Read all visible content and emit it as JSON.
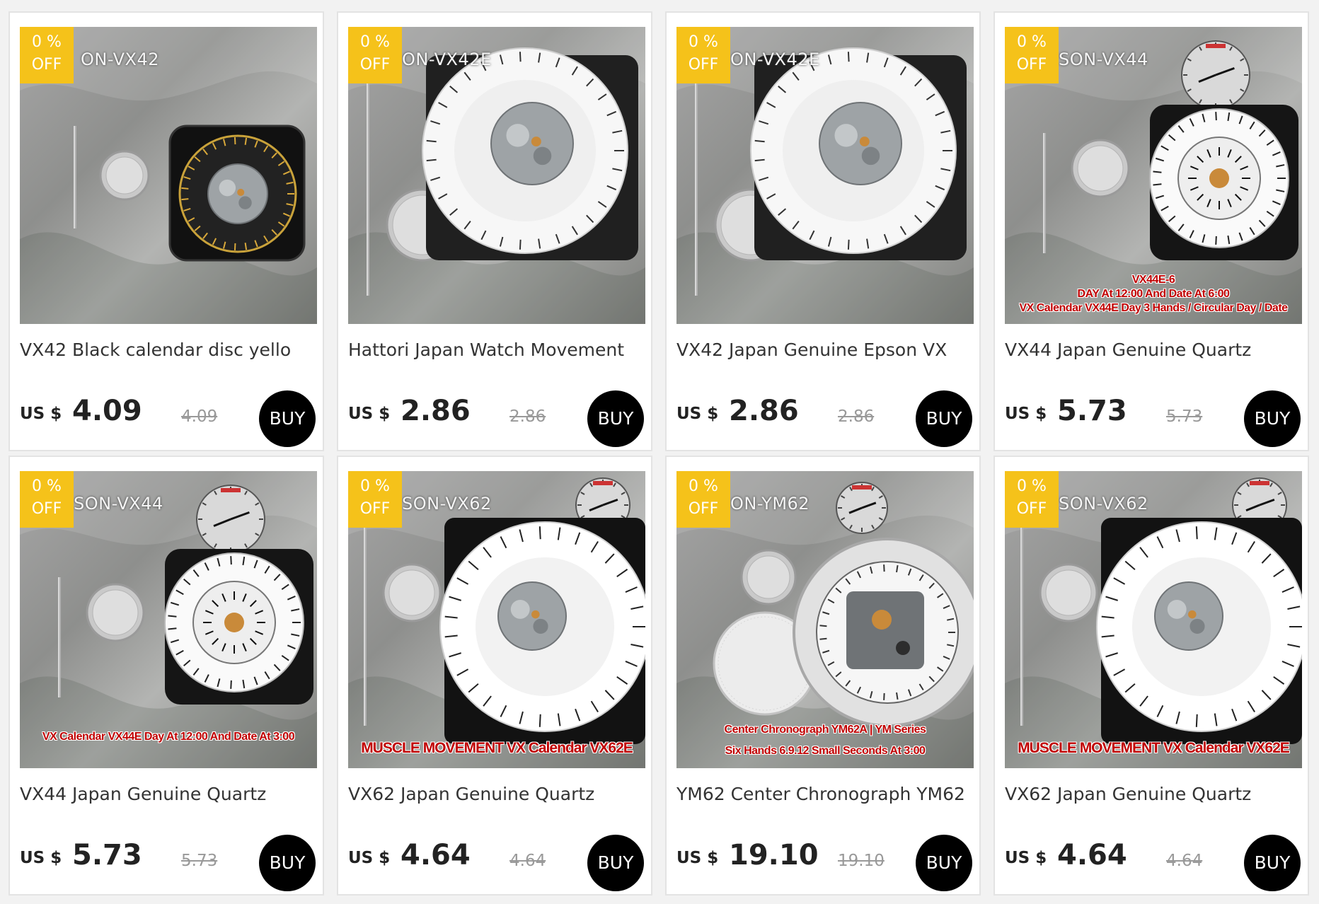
{
  "products": [
    {
      "badge_pct": "0 %",
      "badge_off": "OFF",
      "image_label": "ON-VX42",
      "image_caption": [],
      "title": "VX42 Black calendar disc yello",
      "currency": "US $",
      "price": "4.09",
      "old_price": "4.09",
      "buy_label": "BUY",
      "image_kind": "black-dial"
    },
    {
      "badge_pct": "0 %",
      "badge_off": "OFF",
      "image_label": "ON-VX42E",
      "image_caption": [],
      "title": "Hattori Japan Watch Movement",
      "currency": "US $",
      "price": "2.86",
      "old_price": "2.86",
      "buy_label": "BUY",
      "image_kind": "white-dial"
    },
    {
      "badge_pct": "0 %",
      "badge_off": "OFF",
      "image_label": "ON-VX42E",
      "image_caption": [],
      "title": "VX42 Japan Genuine Epson VX",
      "currency": "US $",
      "price": "2.86",
      "old_price": "2.86",
      "buy_label": "BUY",
      "image_kind": "white-dial"
    },
    {
      "badge_pct": "0 %",
      "badge_off": "OFF",
      "image_label": "SON-VX44",
      "image_caption": [
        "VX44E-6",
        "DAY At 12:00 And Date At 6:00",
        "VX Calendar VX44E Day 3 Hands / Circular Day / Date"
      ],
      "title": "VX44 Japan Genuine Quartz",
      "currency": "US $",
      "price": "5.73",
      "old_price": "5.73",
      "buy_label": "BUY",
      "image_kind": "day-dial"
    },
    {
      "badge_pct": "0 %",
      "badge_off": "OFF",
      "image_label": "SON-VX44",
      "image_caption": [
        "VX Calendar VX44E Day At 12:00 And Date At 3:00"
      ],
      "title": "VX44 Japan Genuine Quartz",
      "currency": "US $",
      "price": "5.73",
      "old_price": "5.73",
      "buy_label": "BUY",
      "image_kind": "day-dial"
    },
    {
      "badge_pct": "0 %",
      "badge_off": "OFF",
      "image_label": "SON-VX62",
      "image_caption": [
        "MUSCLE MOVEMENT VX Calendar VX62E"
      ],
      "title": "VX62 Japan Genuine Quartz",
      "currency": "US $",
      "price": "4.64",
      "old_price": "4.64",
      "buy_label": "BUY",
      "image_kind": "white-dial-big"
    },
    {
      "badge_pct": "0 %",
      "badge_off": "OFF",
      "image_label": "ON-YM62",
      "image_caption": [
        "Center Chronograph YM62A | YM Series",
        "Six Hands 6.9.12 Small Seconds At 3:00"
      ],
      "title": "YM62 Center Chronograph YM62",
      "currency": "US $",
      "price": "19.10",
      "old_price": "19.10",
      "buy_label": "BUY",
      "image_kind": "chrono-dial"
    },
    {
      "badge_pct": "0 %",
      "badge_off": "OFF",
      "image_label": "SON-VX62",
      "image_caption": [
        "MUSCLE MOVEMENT VX Calendar VX62E"
      ],
      "title": "VX62 Japan Genuine Quartz",
      "currency": "US $",
      "price": "4.64",
      "old_price": "4.64",
      "buy_label": "BUY",
      "image_kind": "white-dial-big"
    }
  ],
  "colors": {
    "badge": "#f5c21a",
    "buy_button": "#000000",
    "caption_red": "#c00000",
    "page_bg": "#f2f2f2"
  }
}
